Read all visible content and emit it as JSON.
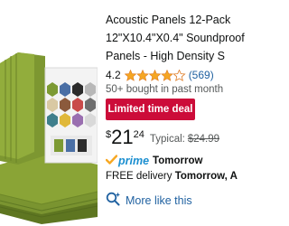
{
  "product": {
    "title_lines": [
      "Acoustic Panels 12-Pack",
      "12\"X10.4\"X0.4\" Soundproof",
      "Panels - High Density S"
    ],
    "rating_value": "4.2",
    "rating_stars": 4.2,
    "review_count": "(569)",
    "bought_text": "50+ bought in past month",
    "deal_badge": "Limited time deal",
    "price": {
      "symbol": "$",
      "whole": "21",
      "fraction": "24"
    },
    "typical_label": "Typical:",
    "typical_price": "$24.99",
    "prime": {
      "label": "prime",
      "delivery_day": "Tomorrow"
    },
    "free_delivery": {
      "prefix": "FREE delivery ",
      "date": "Tomorrow, A"
    },
    "more_like_this": "More like this"
  },
  "colors": {
    "panel_green": "#8aa436",
    "deal_red": "#cc0c39",
    "link_blue": "#2162a1",
    "prime_blue": "#1c8fd0",
    "star_orange": "#f5a623"
  },
  "icons": [
    "star-icon",
    "prime-check-icon",
    "more-like-this-icon"
  ]
}
